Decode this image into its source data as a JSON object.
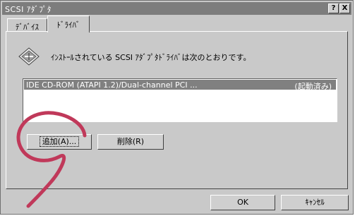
{
  "window": {
    "title": "SCSI ｱﾀﾞﾌﾟﾀ",
    "help_label": "?",
    "close_label": "X"
  },
  "tabs": [
    {
      "label": "ﾃﾞﾊﾞｲｽ",
      "active": false
    },
    {
      "label": "ﾄﾞﾗｲﾊﾞ",
      "active": true
    }
  ],
  "header": {
    "icon": "adapter-diamond-icon",
    "text": "ｲﾝｽﾄｰﾙされている SCSI ｱﾀﾞﾌﾟﾀﾄﾞﾗｲﾊﾞは次のとおりです。"
  },
  "driver_list": {
    "items": [
      {
        "name": "IDE CD-ROM (ATAPI 1.2)/Dual-channel PCI ...",
        "status": "(起動済み)",
        "selected": true
      }
    ]
  },
  "buttons": {
    "add": "追加(A)...",
    "remove": "削除(R)",
    "ok": "OK",
    "cancel": "ｷｬﾝｾﾙ"
  },
  "annotation": {
    "color": "#c0395a",
    "shape": "hand-drawn-loop"
  }
}
